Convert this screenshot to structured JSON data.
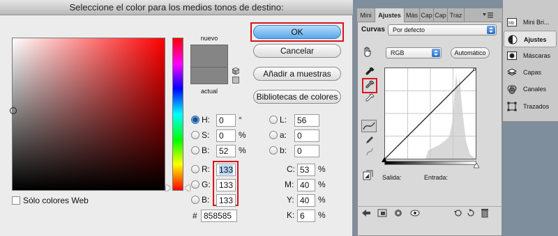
{
  "dialog": {
    "title": "Seleccione el color para los medios tonos de destino:",
    "new_label": "nuevo",
    "current_label": "actual",
    "swatch_color": "#858585",
    "buttons": {
      "ok": "OK",
      "cancel": "Cancelar",
      "add_to_swatches": "Añadir a muestras",
      "color_libraries": "Bibliotecas de colores"
    },
    "fields": {
      "H": {
        "label": "H:",
        "value": "0",
        "unit": "°",
        "selected_radio": true
      },
      "S": {
        "label": "S:",
        "value": "0",
        "unit": "%"
      },
      "B": {
        "label": "B:",
        "value": "52",
        "unit": "%"
      },
      "R": {
        "label": "R:",
        "value": "133"
      },
      "G": {
        "label": "G:",
        "value": "133"
      },
      "Bl": {
        "label": "B:",
        "value": "133"
      },
      "L": {
        "label": "L:",
        "value": "56"
      },
      "a": {
        "label": "a:",
        "value": "0"
      },
      "b": {
        "label": "b:",
        "value": "0"
      },
      "C": {
        "label": "C:",
        "value": "53",
        "unit": "%"
      },
      "M": {
        "label": "M:",
        "value": "40",
        "unit": "%"
      },
      "Y": {
        "label": "Y:",
        "value": "40",
        "unit": "%"
      },
      "K": {
        "label": "K:",
        "value": "6",
        "unit": "%"
      },
      "hex": {
        "label": "#",
        "value": "858585"
      }
    },
    "web_colors_label": "Sólo colores Web",
    "highlight_color": "#d8141c"
  },
  "curves_panel": {
    "tabs": [
      "Mini",
      "Ajustes",
      "Más",
      "Cap",
      "Cap",
      "Traz"
    ],
    "active_tab": "Ajustes",
    "preset_label": "Curvas",
    "preset_value": "Por defecto",
    "channel_value": "RGB",
    "auto_button": "Automático",
    "output_label": "Salida:",
    "input_label": "Entrada:"
  },
  "dock": {
    "items": [
      {
        "label": "Mini Bri...",
        "icon": "mini-bridge-icon"
      },
      {
        "label": "Ajustes",
        "icon": "adjustments-icon",
        "active": true
      },
      {
        "label": "Máscaras",
        "icon": "masks-icon"
      },
      {
        "label": "Capas",
        "icon": "layers-icon"
      },
      {
        "label": "Canales",
        "icon": "channels-icon"
      },
      {
        "label": "Trazados",
        "icon": "paths-icon"
      }
    ]
  }
}
